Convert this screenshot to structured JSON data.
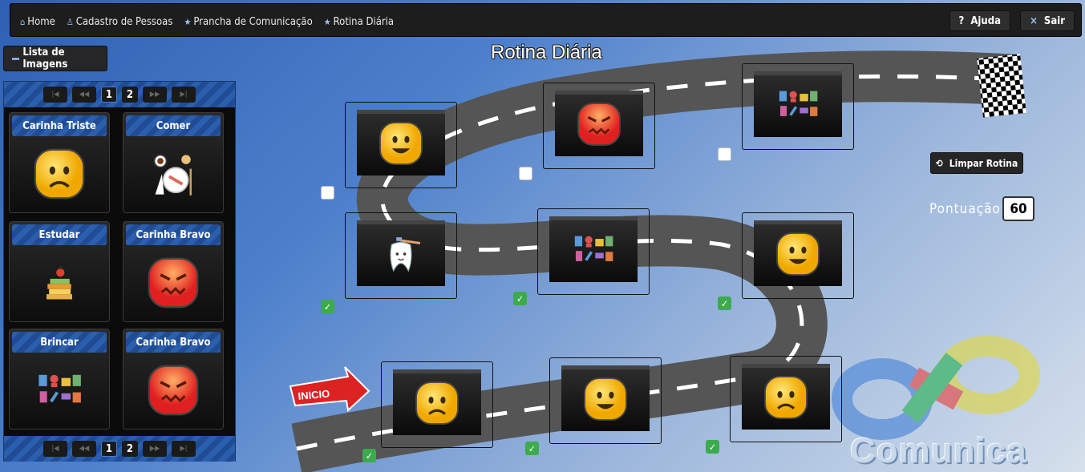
{
  "nav": {
    "items": [
      {
        "label": "Home",
        "icon": "home-icon"
      },
      {
        "label": "Cadastro de Pessoas",
        "icon": "user-icon"
      },
      {
        "label": "Prancha de Comunicação",
        "icon": "star-icon"
      },
      {
        "label": "Rotina Diária",
        "icon": "star-icon"
      }
    ],
    "help_label": "Ajuda",
    "help_icon": "?",
    "exit_label": "Sair",
    "exit_icon": "×"
  },
  "sidebar": {
    "toggle_label": "Lista de Imagens",
    "pager": {
      "pages": [
        "1",
        "2"
      ],
      "current": "1",
      "first": "|◀",
      "prev": "◀◀",
      "next": "▶▶",
      "last": "▶|"
    },
    "cards": [
      {
        "title": "Carinha Triste",
        "image": "sad-face"
      },
      {
        "title": "Comer",
        "image": "eat"
      },
      {
        "title": "Estudar",
        "image": "study"
      },
      {
        "title": "Carinha Bravo",
        "image": "angry-face"
      },
      {
        "title": "Brincar",
        "image": "play"
      },
      {
        "title": "Carinha Bravo",
        "image": "angry-face"
      }
    ]
  },
  "main": {
    "title": "Rotina Diária",
    "start_label": "INICIO",
    "slots": [
      {
        "image": "sad-face",
        "checked": true
      },
      {
        "image": "happy-face",
        "checked": true
      },
      {
        "image": "sad-face",
        "checked": true
      },
      {
        "image": "happy-face",
        "checked": true
      },
      {
        "image": "play",
        "checked": true
      },
      {
        "image": "brush-teeth",
        "checked": true
      },
      {
        "image": "happy-face",
        "checked": false
      },
      {
        "image": "angry-face",
        "checked": false
      },
      {
        "image": "play",
        "checked": false
      }
    ],
    "clear_label": "Limpar Rotina",
    "score_label": "Pontuação:",
    "score_value": "60",
    "brand": "Comunica"
  },
  "colors": {
    "accent": "#2b5fae",
    "check_green": "#3daa4d",
    "topbar": "#1d1d1d",
    "road": "#555555"
  }
}
